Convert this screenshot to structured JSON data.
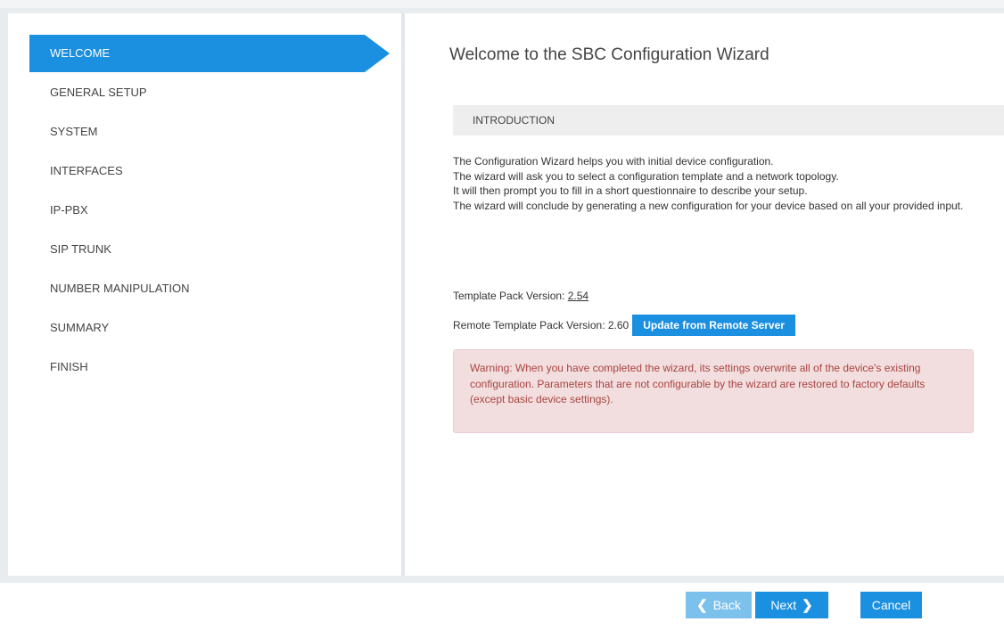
{
  "sidebar": {
    "steps": [
      {
        "label": "WELCOME",
        "active": true
      },
      {
        "label": "GENERAL SETUP",
        "active": false
      },
      {
        "label": "SYSTEM",
        "active": false
      },
      {
        "label": "INTERFACES",
        "active": false
      },
      {
        "label": "IP-PBX",
        "active": false
      },
      {
        "label": "SIP TRUNK",
        "active": false
      },
      {
        "label": "NUMBER MANIPULATION",
        "active": false
      },
      {
        "label": "SUMMARY",
        "active": false
      },
      {
        "label": "FINISH",
        "active": false
      }
    ]
  },
  "main": {
    "title": "Welcome to the SBC Configuration Wizard",
    "section_header": "INTRODUCTION",
    "intro_lines": [
      "The Configuration Wizard helps you with initial device configuration.",
      "The wizard will ask you to select a configuration template and a network topology.",
      "It will then prompt you to fill in a short questionnaire to describe your setup.",
      "The wizard will conclude by generating a new configuration for your device based on all your provided input."
    ],
    "template_pack_label": "Template Pack Version:",
    "template_pack_version": "2.54",
    "remote_template_pack_label": "Remote Template Pack Version: 2.60",
    "update_button": "Update from Remote Server",
    "warning": "Warning: When you have completed the wizard, its settings overwrite all of the device's existing configuration. Parameters that are not configurable by the wizard are restored to factory defaults (except basic device settings)."
  },
  "footer": {
    "back_label": "Back",
    "next_label": "Next",
    "cancel_label": "Cancel",
    "back_icon": "chevron-left-icon",
    "next_icon": "chevron-right-icon"
  },
  "colors": {
    "accent": "#1b8fe0",
    "accent_disabled": "#7cc0ec",
    "warning_bg": "#f2dede",
    "warning_text": "#a94442"
  }
}
